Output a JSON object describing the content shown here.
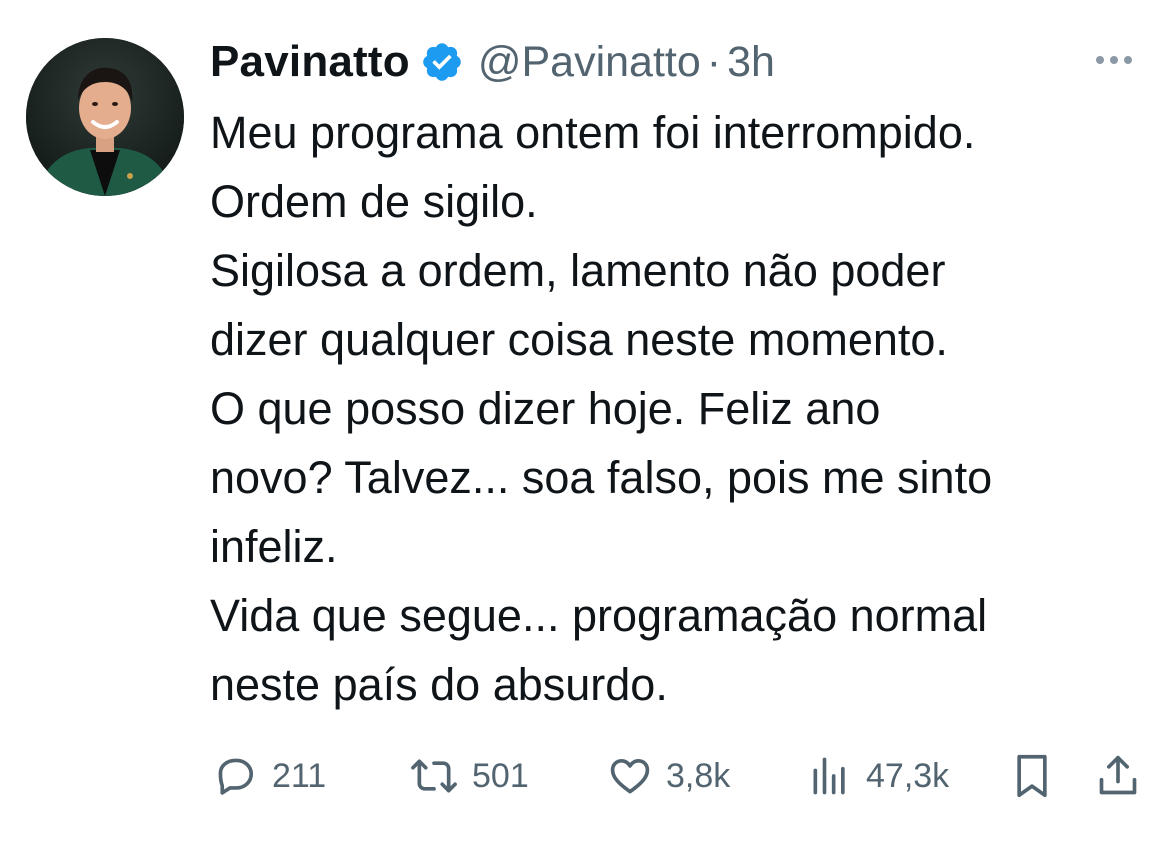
{
  "author": {
    "display_name": "Pavinatto",
    "handle": "@Pavinatto",
    "separator": "·",
    "time": "3h",
    "verified": true,
    "avatar_icon": "profile-photo"
  },
  "tweet": {
    "text": "Meu programa ontem foi interrompido.\nOrdem de sigilo.\nSigilosa a ordem, lamento não poder\ndizer qualquer coisa neste momento.\nO que posso dizer hoje. Feliz ano\nnovo? Talvez... soa falso, pois me sinto\ninfeliz.\nVida que segue... programação normal\nneste país do absurdo."
  },
  "metrics": {
    "replies": "211",
    "retweets": "501",
    "likes": "3,8k",
    "views": "47,3k"
  },
  "icons": {
    "more": "more-horizontal-icon",
    "reply": "reply-bubble-icon",
    "retweet": "retweet-icon",
    "like": "heart-icon",
    "views": "analytics-bars-icon",
    "bookmark": "bookmark-icon",
    "share": "share-upload-icon"
  },
  "colors": {
    "text": "#0f1419",
    "secondary": "#536471",
    "verified_blue": "#1d9bf0",
    "background": "#ffffff"
  }
}
